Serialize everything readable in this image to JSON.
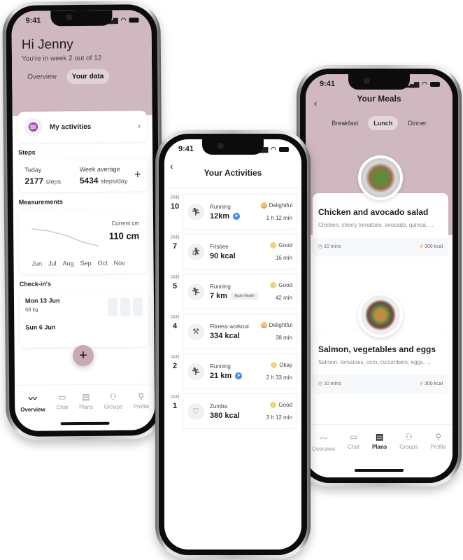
{
  "status_time": "9:41",
  "phone_overview": {
    "greeting": "Hi Jenny",
    "subtitle": "You're in week 2 out of 12",
    "segments": [
      "Overview",
      "Your data"
    ],
    "active_segment": "Your data",
    "my_activities_label": "My activities",
    "steps_label": "Steps",
    "steps": {
      "today_label": "Today",
      "today_value": "2177",
      "today_unit": "steps",
      "avg_label": "Week average",
      "avg_value": "5434",
      "avg_unit": "steps/day"
    },
    "measurements_label": "Measurements",
    "measurement": {
      "current_label": "Current cm",
      "current_value": "110 cm",
      "months": [
        "Jun",
        "Jul",
        "Aug",
        "Sep",
        "Oct",
        "Nov"
      ],
      "trend": [
        118,
        117,
        115,
        112,
        110
      ]
    },
    "checkins_label": "Check-in's",
    "checkins": [
      {
        "date": "Mon 13 Jun",
        "value": "68 kg"
      },
      {
        "date": "Sun 6 Jun",
        "value": ""
      }
    ],
    "fab_label": "+",
    "tabs": [
      "Overview",
      "Chat",
      "Plans",
      "Groups",
      "Profile"
    ],
    "active_tab": "Overview"
  },
  "phone_activities": {
    "title": "Your Activities",
    "back_icon": "chevron-left-icon",
    "items": [
      {
        "month": "JAN",
        "day": "10",
        "name": "Running",
        "value": "12km",
        "source": "location",
        "mood": "Delightful",
        "duration": "1 h 12 min",
        "icon": "running-icon"
      },
      {
        "month": "JAN",
        "day": "7",
        "name": "Frisbee",
        "value": "90 kcal",
        "source": "",
        "mood": "Good",
        "duration": "16 min",
        "icon": "frisbee-icon"
      },
      {
        "month": "JAN",
        "day": "5",
        "name": "Running",
        "value": "7 km",
        "source": "Apple Health",
        "mood": "Good",
        "duration": "42 min",
        "icon": "running-icon"
      },
      {
        "month": "JAN",
        "day": "4",
        "name": "Fitness workout",
        "value": "334 kcal",
        "source": "",
        "mood": "Delightful",
        "duration": "38 min",
        "icon": "dumbbell-icon"
      },
      {
        "month": "JAN",
        "day": "2",
        "name": "Running",
        "value": "21 km",
        "source": "location",
        "mood": "Okay",
        "duration": "2 h 33 min",
        "icon": "running-icon"
      },
      {
        "month": "JAN",
        "day": "1",
        "name": "Zumba",
        "value": "380 kcal",
        "source": "",
        "mood": "Good",
        "duration": "3 h 12 min",
        "icon": "heart-icon"
      }
    ]
  },
  "phone_meals": {
    "title": "Your Meals",
    "tabs": [
      "Breakfast",
      "Lunch",
      "Dinner"
    ],
    "active_tab": "Lunch",
    "meals": [
      {
        "title": "Chicken and avocado salad",
        "desc": "Chicken, cherry tomatoes, avocado, quinoa, ...",
        "time": "10 mins",
        "kcal": "300 kcal"
      },
      {
        "title": "Salmon, vegetables and eggs",
        "desc": "Salmon, tomatoes, corn, cucumbers, eggs, ...",
        "time": "10 mins",
        "kcal": "300 kcal"
      }
    ],
    "bottom_tabs": [
      "Overview",
      "Chat",
      "Plans",
      "Groups",
      "Profile"
    ],
    "active_bottom_tab": "Plans"
  },
  "colors": {
    "accent_pink": "#cfb8bf",
    "fab": "#c7aab2",
    "link_blue": "#3d8ce6",
    "bolt": "#f2b90c"
  }
}
